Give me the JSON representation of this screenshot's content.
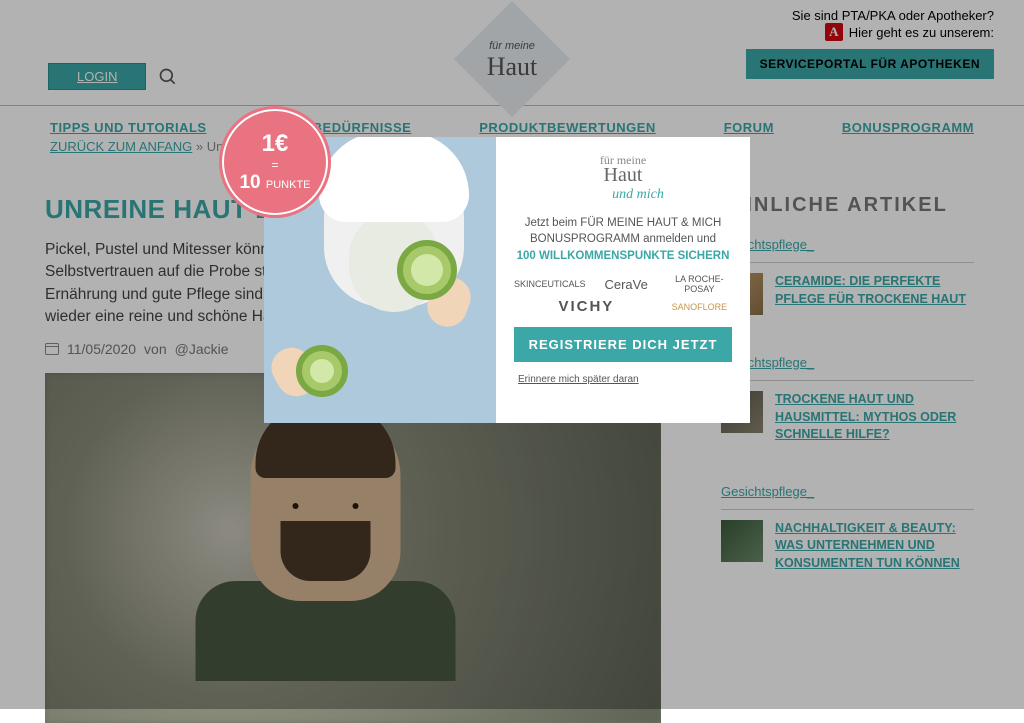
{
  "header": {
    "pta_line": "Sie sind PTA/PKA oder Apotheker?",
    "portal_link": "Hier geht es zu unserem:",
    "service_button": "SERVICEPORTAL FÜR APOTHEKEN",
    "login": "LOGIN",
    "logo_sub": "für meine",
    "logo_main": "Haut"
  },
  "nav": {
    "items": [
      "TIPPS UND TUTORIALS",
      "HAUTBEDÜRFNISSE",
      "PRODUKTBEWERTUNGEN",
      "FORUM",
      "BONUSPROGRAMM"
    ]
  },
  "breadcrumb": {
    "back": "ZURÜCK ZUM ANFANG",
    "sep": "»",
    "current": "Unreine Haut beim Mann"
  },
  "article": {
    "title": "UNREINE HAUT BEIM MANN",
    "body": "Pickel, Pustel und Mitesser können unser Wohlbefinden, unsere Gesundheit und unser Selbstvertrauen auf die Probe stellen. Regelmäßige Bewegung, eine ausgewogene Ernährung und gute Pflege sind der Schlüssel zu einer reinen Haut. Mehr dazu, wie Du wieder eine reine und schöne Haut bekommen, erfährst Du hier.",
    "date": "11/05/2020",
    "author_prefix": "von",
    "author": "@Jackie"
  },
  "sidebar": {
    "title": "ÄHNLICHE ARTIKEL",
    "items": [
      {
        "category": "Gesichtspflege_",
        "title": "CERAMIDE: DIE PERFEKTE PFLEGE FÜR TROCKENE HAUT"
      },
      {
        "category": "Gesichtspflege_",
        "title": "TROCKENE HAUT UND HAUSMITTEL: MYTHOS ODER SCHNELLE HILFE?"
      },
      {
        "category": "Gesichtspflege_",
        "title": "NACHHALTIGKEIT & BEAUTY: WAS UNTERNEHMEN UND KONSUMENTEN TUN KÖNNEN"
      }
    ]
  },
  "modal": {
    "badge_1e": "1€",
    "badge_eq": "=",
    "badge_10": "10",
    "badge_pts": "PUNKTE",
    "logo_sub": "für meine",
    "logo_main": "Haut",
    "logo_mich": "und mich",
    "line1": "Jetzt beim FÜR MEINE HAUT & MICH BONUSPROGRAMM anmelden und",
    "line2": "100 WILLKOMMENSPUNKTE SICHERN",
    "brands": [
      "SKINCEUTICALS",
      "CeraVe",
      "LA ROCHE-POSAY",
      "VICHY",
      "SANOFLORE"
    ],
    "register": "REGISTRIERE DICH JETZT",
    "later": "Erinnere mich später daran"
  }
}
